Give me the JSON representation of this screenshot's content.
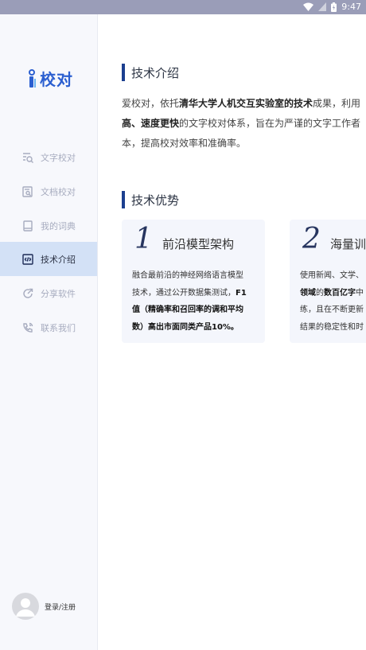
{
  "status": {
    "time": "9:47"
  },
  "logo": {
    "text": "校对"
  },
  "sidebar": {
    "items": [
      {
        "label": "文字校对",
        "icon": "text-search-icon",
        "active": false
      },
      {
        "label": "文档校对",
        "icon": "document-search-icon",
        "active": false
      },
      {
        "label": "我的词典",
        "icon": "book-icon",
        "active": false
      },
      {
        "label": "技术介绍",
        "icon": "code-icon",
        "active": true
      },
      {
        "label": "分享软件",
        "icon": "share-icon",
        "active": false
      },
      {
        "label": "联系我们",
        "icon": "phone-icon",
        "active": false
      }
    ],
    "login_label": "登录/注册"
  },
  "main": {
    "tech_intro": {
      "title": "技术介绍",
      "lines": [
        [
          "爱校对，依托",
          "清华大学人机交互实验室的技术",
          "成果，利用"
        ],
        [
          "高、速度更快",
          "的文字校对体系，旨在为严谨的文字工作者"
        ],
        [
          "本，提高校对效率和准确率。"
        ]
      ]
    },
    "tech_advantage": {
      "title": "技术优势",
      "cards": [
        {
          "number": "1",
          "title": "前沿模型架构",
          "body": [
            "融合最前沿的神经网络语言模型",
            "技术，通过公开数据集测试，",
            "F1",
            "值（精确率和召回率的调和平均",
            "数）高出市面同类产品10%。"
          ]
        },
        {
          "number": "2",
          "title": "海量训",
          "body": [
            "使用新闻、文学、",
            "领域",
            "的",
            "数百亿字",
            "中",
            "练，且在不断更新",
            "结果的稳定性和时"
          ]
        }
      ]
    }
  },
  "colors": {
    "accent": "#1c3f8f",
    "logo": "#2b5fd0",
    "active_bg": "#d3e1f6"
  }
}
